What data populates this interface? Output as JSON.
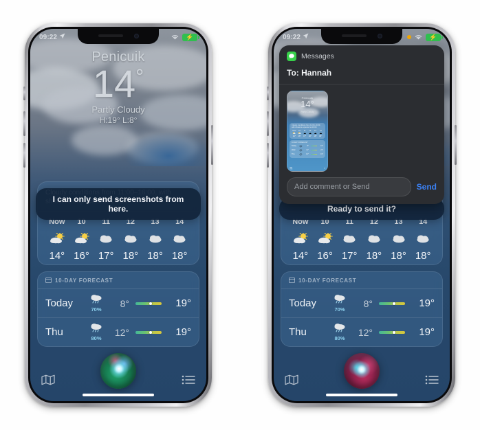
{
  "status_bar": {
    "time": "09:22",
    "location_arrow": "location-arrow",
    "wifi": "wifi-icon",
    "battery": "battery-charging",
    "mic_indicator": "orange-dot"
  },
  "weather": {
    "city": "Penicuik",
    "temperature": "14",
    "degree": "°",
    "condition": "Partly Cloudy",
    "high_low": "H:19°  L:8°",
    "summary": "Cloudy conditions from 11:00–16:00, with showers expected at 16:00.",
    "hourly": [
      {
        "label": "Now",
        "icon": "sun-behind-cloud",
        "temp": "14°"
      },
      {
        "label": "10",
        "icon": "sun-behind-cloud",
        "temp": "16°"
      },
      {
        "label": "11",
        "icon": "cloud",
        "temp": "17°"
      },
      {
        "label": "12",
        "icon": "cloud",
        "temp": "18°"
      },
      {
        "label": "13",
        "icon": "cloud",
        "temp": "18°"
      },
      {
        "label": "14",
        "icon": "cloud",
        "temp": "18°"
      }
    ],
    "ten_day": {
      "header": "10-DAY FORECAST",
      "header_icon": "calendar-icon",
      "rows": [
        {
          "day": "Today",
          "icon": "cloud-with-rain",
          "precip": "70%",
          "low": "8°",
          "high": "19°"
        },
        {
          "day": "Thu",
          "icon": "cloud-with-rain",
          "precip": "80%",
          "low": "12°",
          "high": "19°"
        }
      ]
    },
    "tabbar": {
      "map": "map-icon",
      "list": "list-icon"
    }
  },
  "siri": {
    "left_response": "I can only send screenshots from here.",
    "right_response": "Ready to send it?",
    "orb_left": "siri-orb-green",
    "orb_right": "siri-orb-pink"
  },
  "messages_sheet": {
    "app_name": "Messages",
    "app_icon": "messages-icon",
    "recipient": "To: Hannah",
    "attachment": "weather-screenshot-thumbnail",
    "input_placeholder": "Add comment or Send",
    "input_value": "",
    "send_label": "Send"
  },
  "colors": {
    "accent_send": "#3b82f6",
    "messages_green": "#37d04a",
    "battery_green": "#2fbf4e",
    "precip_blue": "#8fd4f0",
    "banner_bg": "#11243a"
  }
}
